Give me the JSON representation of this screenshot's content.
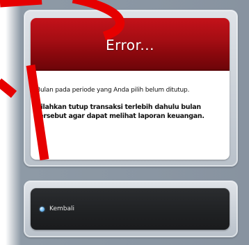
{
  "dialog": {
    "title": "Error...",
    "message": "Bulan pada periode yang Anda pilih belum ditutup.",
    "instruction": "Silahkan tutup transaksi terlebih dahulu bulan tersebut agar dapat melihat laporan keuangan."
  },
  "nav": {
    "back_label": "Kembali",
    "back_icon": "bullet-icon"
  },
  "colors": {
    "header": "#a30d13",
    "background": "#8a96a3",
    "back_bar": "#1f2123",
    "watermark": "#e60000"
  }
}
